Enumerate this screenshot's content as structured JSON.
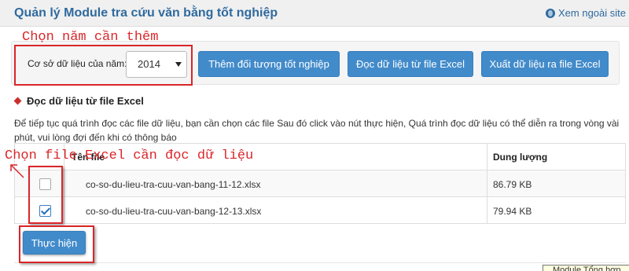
{
  "header": {
    "title": "Quản lý Module tra cứu văn bằng tốt nghiệp",
    "outside_link": "Xem ngoài site",
    "outside_icon": "globe-icon"
  },
  "toolbar": {
    "year_label": "Cơ sở dữ liệu của năm:",
    "year_selected": "2014",
    "add_button": "Thêm đối tượng tốt nghiệp",
    "read_button": "Đọc dữ liệu từ file Excel",
    "export_button": "Xuất dữ liệu ra file Excel"
  },
  "section": {
    "title": "Đọc dữ liệu từ file Excel",
    "description": "Để tiếp tục quá trình đọc các file dữ liệu, bạn cần chọn các file Sau đó click vào nút thực hiện, Quá trình đọc dữ liệu có thể diễn ra trong vòng vài phút, vui lòng đợi đến khi có thông báo"
  },
  "table": {
    "columns": [
      "",
      "Tên file",
      "Dung lượng"
    ],
    "rows": [
      {
        "checked": false,
        "filename": "co-so-du-lieu-tra-cuu-van-bang-11-12.xlsx",
        "size": "86.79 KB"
      },
      {
        "checked": true,
        "filename": "co-so-du-lieu-tra-cuu-van-bang-12-13.xlsx",
        "size": "79.94 KB"
      }
    ]
  },
  "run_button": "Thực hiện",
  "tooltip": "Module Tổng hợp",
  "annotations": {
    "year_note": "Chọn năm cần thêm",
    "file_note": "Chọn file Excel cần đọc dữ liệu",
    "color": "#d9262a"
  },
  "colors": {
    "primary": "#428bca",
    "title": "#2f6a9e"
  }
}
